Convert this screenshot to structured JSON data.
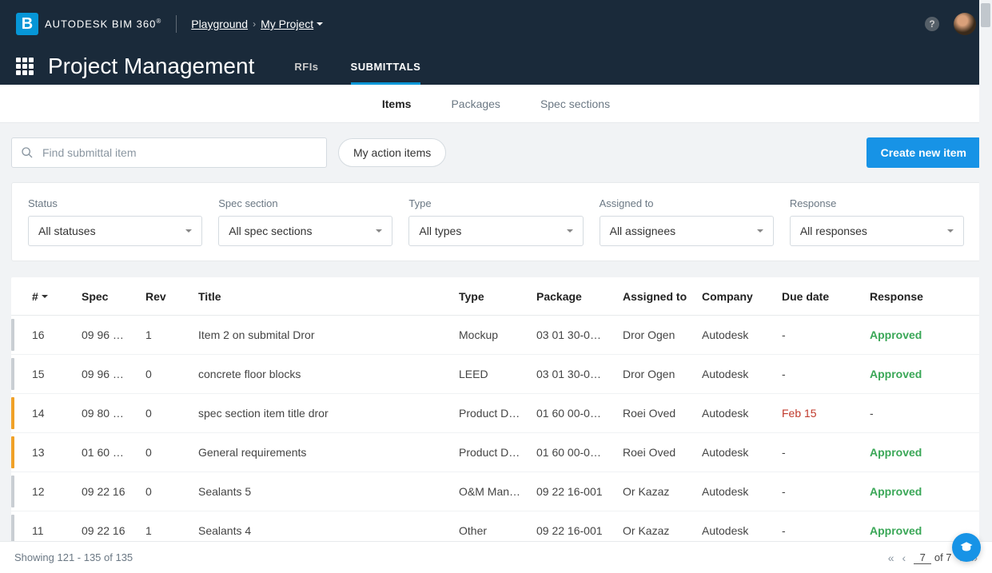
{
  "header": {
    "brand_prefix": "AUTODESK",
    "brand_suffix": "BIM 360",
    "workspace": "Playground",
    "project": "My Project"
  },
  "page": {
    "title": "Project Management",
    "top_tabs": [
      {
        "label": "RFIs",
        "active": false
      },
      {
        "label": "SUBMITTALS",
        "active": true
      }
    ],
    "sub_tabs": [
      {
        "label": "Items",
        "active": true
      },
      {
        "label": "Packages",
        "active": false
      },
      {
        "label": "Spec sections",
        "active": false
      }
    ]
  },
  "toolbar": {
    "search_placeholder": "Find submittal item",
    "action_items_label": "My action items",
    "create_label": "Create new item"
  },
  "filters": [
    {
      "label": "Status",
      "value": "All statuses"
    },
    {
      "label": "Spec section",
      "value": "All spec sections"
    },
    {
      "label": "Type",
      "value": "All types"
    },
    {
      "label": "Assigned to",
      "value": "All assignees"
    },
    {
      "label": "Response",
      "value": "All responses"
    }
  ],
  "table": {
    "columns": [
      "#",
      "Spec",
      "Rev",
      "Title",
      "Type",
      "Package",
      "Assigned to",
      "Company",
      "Due date",
      "Response"
    ],
    "rows": [
      {
        "status": "closed",
        "num": "16",
        "spec": "09 96 …",
        "rev": "1",
        "title": "Item 2 on submital Dror",
        "type": "Mockup",
        "package": "03 01 30-0…",
        "assigned": "Dror Ogen",
        "company": "Autodesk",
        "due": "-",
        "due_overdue": false,
        "response": "Approved"
      },
      {
        "status": "closed",
        "num": "15",
        "spec": "09 96 …",
        "rev": "0",
        "title": "concrete floor blocks",
        "type": "LEED",
        "package": "03 01 30-0…",
        "assigned": "Dror Ogen",
        "company": "Autodesk",
        "due": "-",
        "due_overdue": false,
        "response": "Approved"
      },
      {
        "status": "open",
        "num": "14",
        "spec": "09 80 …",
        "rev": "0",
        "title": "spec section item title dror",
        "type": "Product D…",
        "package": "01 60 00-0…",
        "assigned": "Roei Oved",
        "company": "Autodesk",
        "due": "Feb 15",
        "due_overdue": true,
        "response": "-"
      },
      {
        "status": "open",
        "num": "13",
        "spec": "01 60 …",
        "rev": "0",
        "title": "General requirements",
        "type": "Product D…",
        "package": "01 60 00-0…",
        "assigned": "Roei Oved",
        "company": "Autodesk",
        "due": "-",
        "due_overdue": false,
        "response": "Approved"
      },
      {
        "status": "closed",
        "num": "12",
        "spec": "09 22 16",
        "rev": "0",
        "title": "Sealants 5",
        "type": "O&M Man…",
        "package": "09 22 16-001",
        "assigned": "Or Kazaz",
        "company": "Autodesk",
        "due": "-",
        "due_overdue": false,
        "response": "Approved"
      },
      {
        "status": "closed",
        "num": "11",
        "spec": "09 22 16",
        "rev": "1",
        "title": "Sealants 4",
        "type": "Other",
        "package": "09 22 16-001",
        "assigned": "Or Kazaz",
        "company": "Autodesk",
        "due": "-",
        "due_overdue": false,
        "response": "Approved"
      }
    ]
  },
  "footer": {
    "showing": "Showing 121 - 135 of 135",
    "page_current": "7",
    "page_of": "of 7"
  }
}
